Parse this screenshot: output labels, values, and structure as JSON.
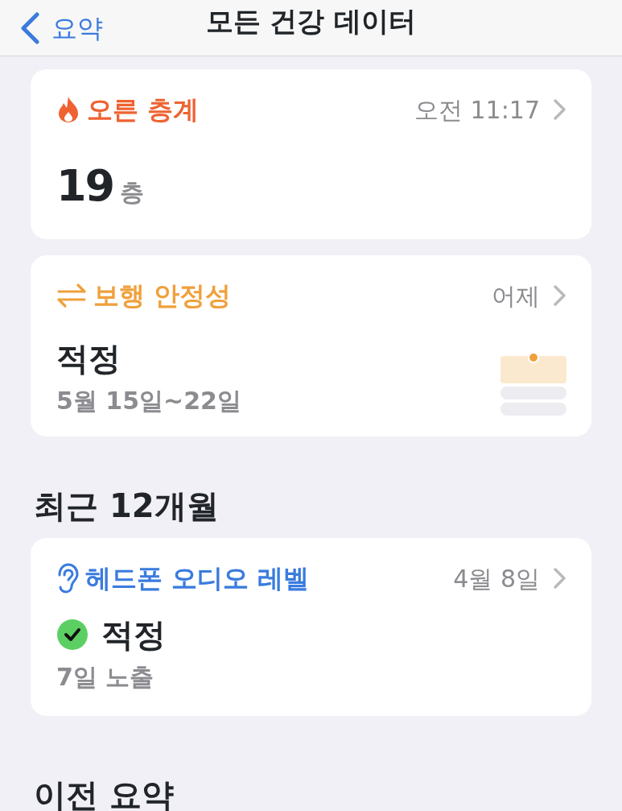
{
  "nav": {
    "back_label": "요약",
    "title": "모든 건강 데이터"
  },
  "sections": [
    {
      "cards": [
        {
          "kind": "value",
          "title": "오른 층계",
          "color": "#ee6331",
          "time": "오전 11:17",
          "value": "19",
          "unit": "층"
        },
        {
          "kind": "chart",
          "title": "보행 안정성",
          "color": "#f0a03c",
          "time": "어제",
          "value": "적정",
          "detail": "5월 15일~22일"
        }
      ]
    },
    {
      "heading": "최근 12개월",
      "cards": [
        {
          "kind": "check",
          "title": "헤드폰 오디오 레벨",
          "color": "#3a7bde",
          "time": "4월 8일",
          "value": "적정",
          "detail": "7일 노출"
        }
      ]
    },
    {
      "heading": "이전 요약"
    }
  ]
}
